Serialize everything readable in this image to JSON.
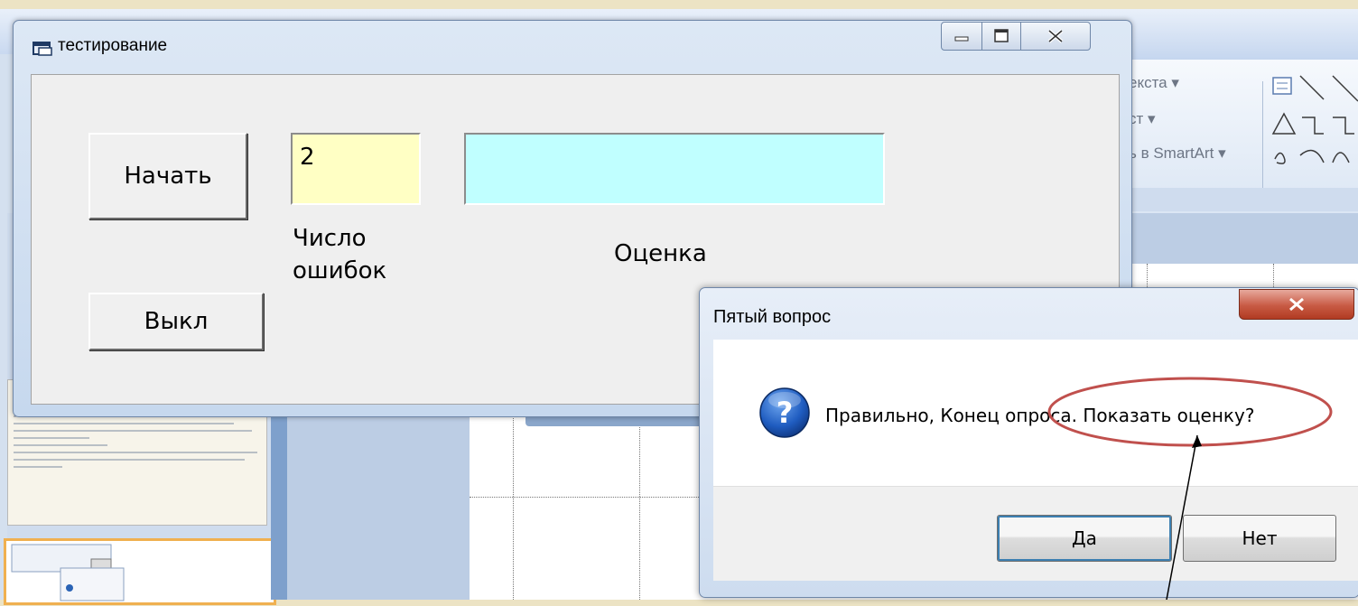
{
  "main_window": {
    "title": "тестирование",
    "start_button": "Начать",
    "off_button": "Выкл",
    "errors_value": "2",
    "errors_label": "Число\nошибок",
    "grade_value": "",
    "grade_label": "Оценка"
  },
  "message_box": {
    "title": "Пятый вопрос",
    "text": "Правильно, Конец опроса. Показать оценку?",
    "yes_button": "Да",
    "no_button": "Нет",
    "icon": "question-icon"
  },
  "background_ribbon": {
    "item1": "екста",
    "item2": "ст",
    "item3": "ь в SmartArt"
  },
  "colors": {
    "errors_field": "#ffffc4",
    "grade_field": "#c0ffff",
    "annotation_ellipse": "#c0504d"
  }
}
